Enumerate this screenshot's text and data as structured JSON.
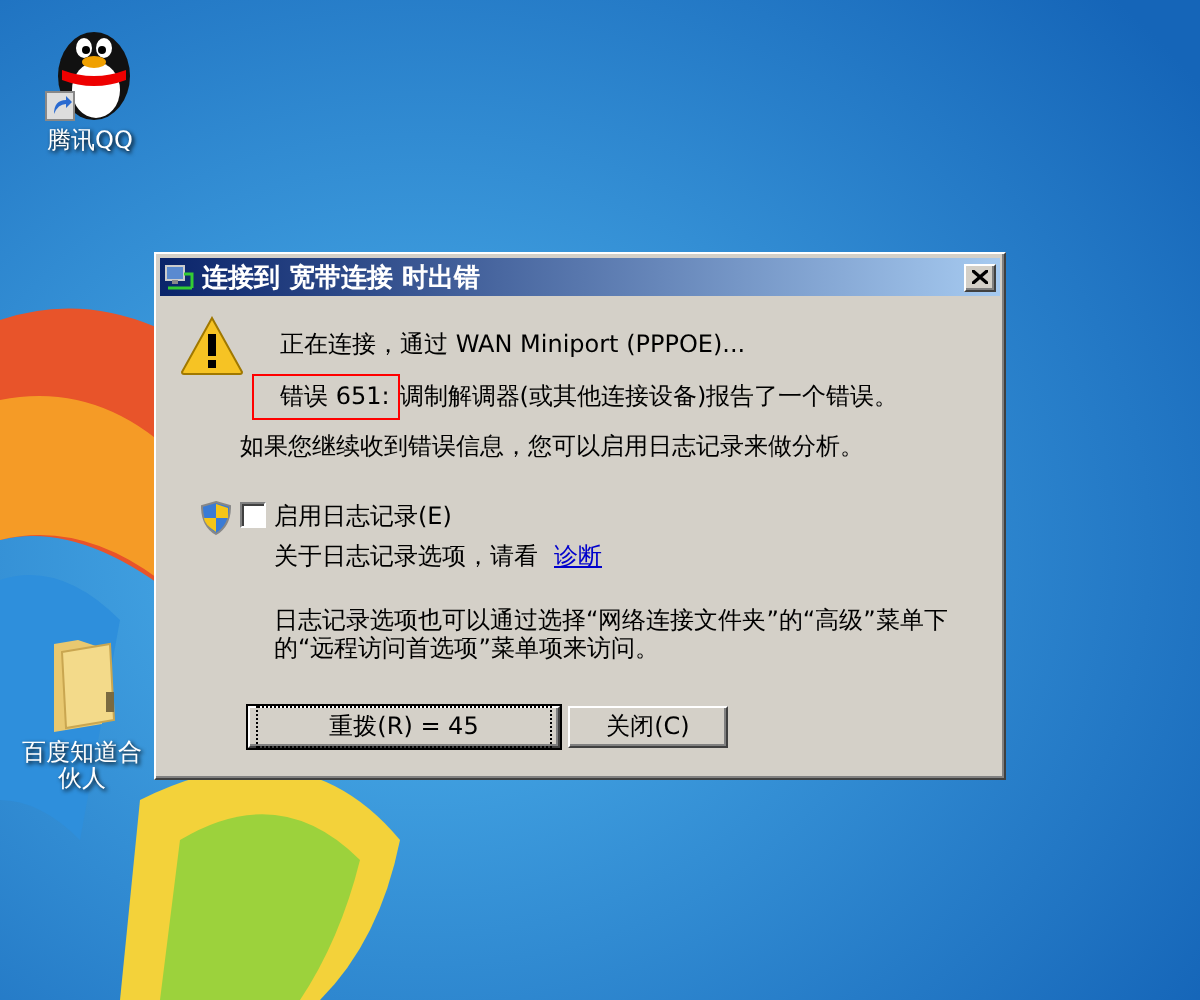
{
  "desktop": {
    "icons": [
      {
        "label": "腾讯QQ",
        "kind": "penguin"
      },
      {
        "label": "百度知道合伙人",
        "kind": "folder"
      }
    ]
  },
  "dialog": {
    "title": "连接到 宽带连接 时出错",
    "status": "正在连接，通过 WAN Miniport (PPPOE)...",
    "error_code": "错误 651:",
    "error_message": "调制解调器(或其他连接设备)报告了一个错误。",
    "hint": "如果您继续收到错误信息，您可以启用日志记录来做分析。",
    "logging": {
      "label": "启用日志记录(E)",
      "checked": false
    },
    "diagnose_text": "关于日志记录选项，请看",
    "diagnose_link": "诊断",
    "note": "日志记录选项也可以通过选择“网络连接文件夹”的“高级”菜单下的“远程访问首选项”菜单项来访问。",
    "buttons": [
      {
        "label": "重拨(R) = 45",
        "default": true
      },
      {
        "label": "关闭(C)",
        "default": false
      }
    ]
  }
}
